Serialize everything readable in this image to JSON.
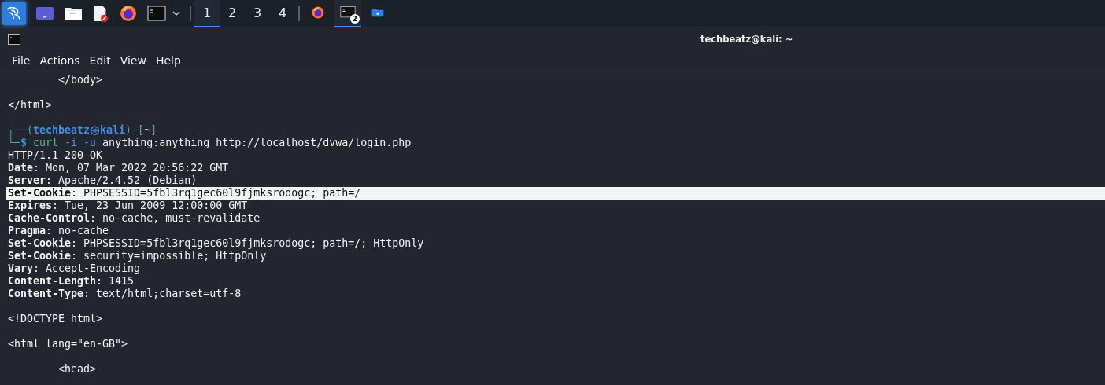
{
  "taskbar": {
    "launchers": [
      {
        "kind": "kali"
      },
      {
        "kind": "desktop"
      },
      {
        "kind": "files"
      },
      {
        "kind": "editor"
      },
      {
        "kind": "browser"
      },
      {
        "kind": "terminal"
      },
      {
        "kind": "caret"
      }
    ],
    "workspaces": [
      {
        "label": "1",
        "selected": true
      },
      {
        "label": "2",
        "selected": false
      },
      {
        "label": "3",
        "selected": false
      },
      {
        "label": "4",
        "selected": false
      }
    ],
    "windows": [
      {
        "kind": "browser",
        "selected": false
      },
      {
        "kind": "terminal",
        "selected": true,
        "badge": "2"
      },
      {
        "kind": "folder",
        "selected": false
      }
    ]
  },
  "terminal": {
    "title": "techbeatz@kali: ~",
    "menu": [
      "File",
      "Actions",
      "Edit",
      "View",
      "Help"
    ],
    "lines": [
      {
        "kind": "text",
        "text": "        </body>",
        "selected": false
      },
      {
        "kind": "blank",
        "selected": false
      },
      {
        "kind": "text",
        "text": "</html>",
        "selected": false
      },
      {
        "kind": "blank",
        "selected": false
      },
      {
        "kind": "segments",
        "selected": false,
        "segments": [
          {
            "text": "┌──(",
            "kind": "frame"
          },
          {
            "text": "techbeatz㉿kali",
            "kind": "user"
          },
          {
            "text": ")-[",
            "kind": "frame"
          },
          {
            "text": "~",
            "kind": "plain"
          },
          {
            "text": "]",
            "kind": "frame"
          }
        ]
      },
      {
        "kind": "segments",
        "selected": false,
        "segments": [
          {
            "text": "└─",
            "kind": "frame"
          },
          {
            "text": "$ ",
            "kind": "user"
          },
          {
            "text": "curl",
            "kind": "command"
          },
          {
            "text": " -i -u",
            "kind": "option"
          },
          {
            "text": " anything:anything http://localhost/dvwa/login.php",
            "kind": "plain"
          }
        ]
      },
      {
        "kind": "text",
        "text": "HTTP/1.1 200 OK",
        "selected": false
      },
      {
        "kind": "text",
        "text": "**Date**: Mon, 07 Mar 2022 20:56:22 GMT",
        "selected": false
      },
      {
        "kind": "text",
        "text": "**Server**: Apache/2.4.52 (Debian)",
        "selected": false
      },
      {
        "kind": "text",
        "text": "**Set-Cookie**: PHPSESSID=5fbl3rq1gec60l9fjmksrodogc; path=/",
        "selected": true
      },
      {
        "kind": "text",
        "text": "**Expires**: Tue, 23 Jun 2009 12:00:00 GMT",
        "selected": false
      },
      {
        "kind": "text",
        "text": "**Cache-Control**: no-cache, must-revalidate",
        "selected": false
      },
      {
        "kind": "text",
        "text": "**Pragma**: no-cache",
        "selected": false
      },
      {
        "kind": "text",
        "text": "**Set-Cookie**: PHPSESSID=5fbl3rq1gec60l9fjmksrodogc; path=/; HttpOnly",
        "selected": false
      },
      {
        "kind": "text",
        "text": "**Set-Cookie**: security=impossible; HttpOnly",
        "selected": false
      },
      {
        "kind": "text",
        "text": "**Vary**: Accept-Encoding",
        "selected": false
      },
      {
        "kind": "text",
        "text": "**Content-Length**: 1415",
        "selected": false
      },
      {
        "kind": "text",
        "text": "**Content-Type**: text/html;charset=utf-8",
        "selected": false
      },
      {
        "kind": "blank",
        "selected": false
      },
      {
        "kind": "text",
        "text": "<!DOCTYPE html>",
        "selected": false
      },
      {
        "kind": "blank",
        "selected": false
      },
      {
        "kind": "text",
        "text": "<html lang=\"en-GB\">",
        "selected": false
      },
      {
        "kind": "blank",
        "selected": false
      },
      {
        "kind": "text",
        "text": "        <head>",
        "selected": false
      }
    ]
  }
}
